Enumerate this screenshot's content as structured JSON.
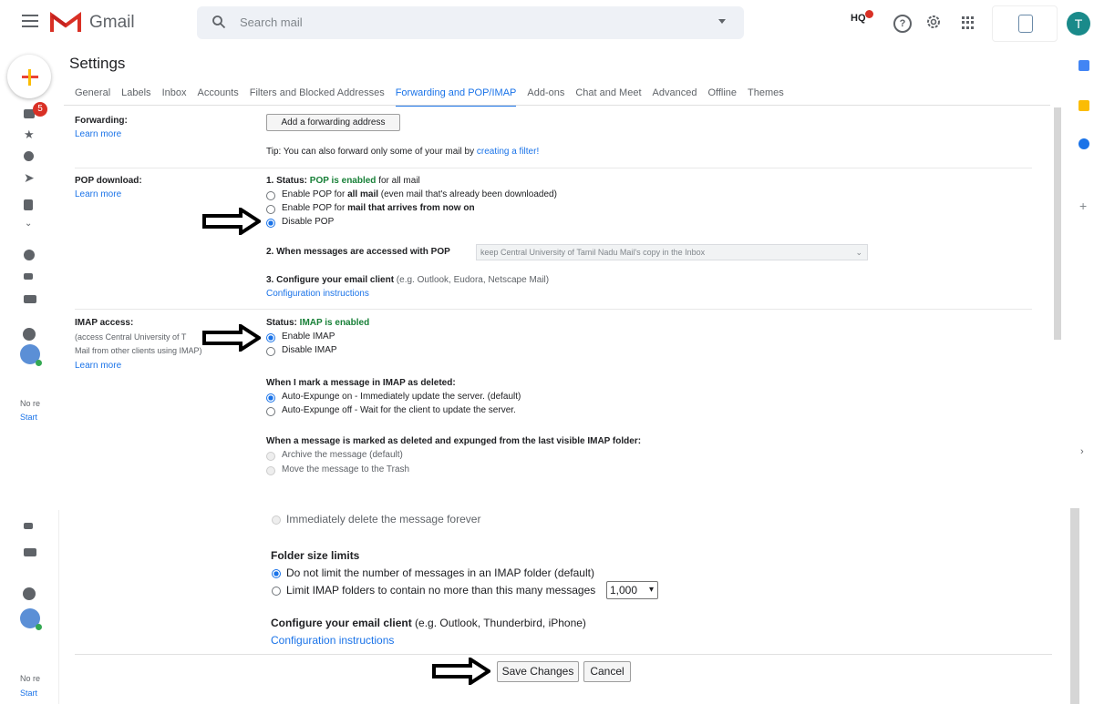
{
  "header": {
    "app_name": "Gmail",
    "search_placeholder": "Search mail",
    "hq_label": "HQ",
    "avatar_letter": "T"
  },
  "sidebar": {
    "inbox_badge": "5",
    "no_recent_top": "No re",
    "start_top": "Start",
    "no_recent_bottom": "No re",
    "start_bottom": "Start"
  },
  "settings": {
    "title": "Settings",
    "tabs": [
      "General",
      "Labels",
      "Inbox",
      "Accounts",
      "Filters and Blocked Addresses",
      "Forwarding and POP/IMAP",
      "Add-ons",
      "Chat and Meet",
      "Advanced",
      "Offline",
      "Themes"
    ],
    "active_tab": "Forwarding and POP/IMAP"
  },
  "forwarding": {
    "label": "Forwarding:",
    "learn_more": "Learn more",
    "add_button": "Add a forwarding address",
    "tip_prefix": "Tip: You can also forward only some of your mail by ",
    "tip_link": "creating a filter!"
  },
  "pop": {
    "label": "POP download:",
    "learn_more": "Learn more",
    "status_label": "1. Status: ",
    "status_value": "POP is enabled",
    "status_suffix": " for all mail",
    "opt1_prefix": "Enable POP for ",
    "opt1_bold": "all mail",
    "opt1_suffix": " (even mail that's already been downloaded)",
    "opt2_prefix": "Enable POP for ",
    "opt2_bold": "mail that arrives from now on",
    "opt3": "Disable POP",
    "accessed_label": "2. When messages are accessed with POP",
    "accessed_select": "keep Central University of Tamil Nadu Mail's copy in the Inbox",
    "configure_label": "3. Configure your email client",
    "configure_hint": " (e.g. Outlook, Eudora, Netscape Mail)",
    "config_link": "Configuration instructions"
  },
  "imap": {
    "label": "IMAP access:",
    "desc1": "(access Central University of T",
    "desc2": "Mail from other clients using IMAP)",
    "learn_more": "Learn more",
    "status_label": "Status: ",
    "status_value": "IMAP is enabled",
    "enable": "Enable IMAP",
    "disable": "Disable IMAP",
    "deleted_heading": "When I mark a message in IMAP as deleted:",
    "expunge_on": "Auto-Expunge on - Immediately update the server. (default)",
    "expunge_off": "Auto-Expunge off - Wait for the client to update the server.",
    "expunged_heading": "When a message is marked as deleted and expunged from the last visible IMAP folder:",
    "archive": "Archive the message (default)",
    "trash": "Move the message to the Trash",
    "delete_forever": "Immediately delete the message forever",
    "folder_heading": "Folder size limits",
    "no_limit": "Do not limit the number of messages in an IMAP folder (default)",
    "limit": "Limit IMAP folders to contain no more than this many messages",
    "limit_value": "1,000",
    "configure_label": "Configure your email client",
    "configure_hint": " (e.g. Outlook, Thunderbird, iPhone)",
    "config_link": "Configuration instructions"
  },
  "actions": {
    "save": "Save Changes",
    "cancel": "Cancel"
  }
}
